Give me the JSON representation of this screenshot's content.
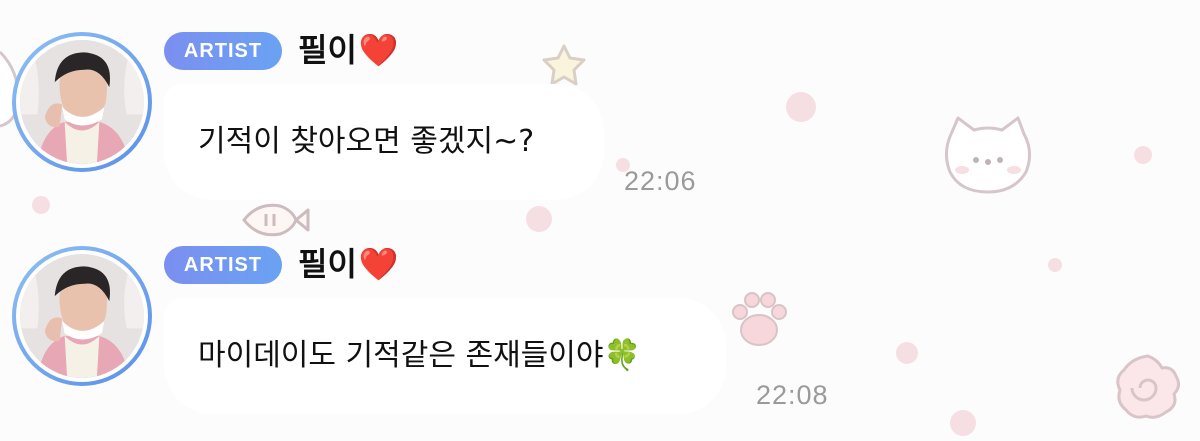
{
  "messages": [
    {
      "badge": "ARTIST",
      "sender_name": "필이",
      "heart": "❤️",
      "text": "기적이 찾아오면 좋겠지~?",
      "time": "22:06"
    },
    {
      "badge": "ARTIST",
      "sender_name": "필이",
      "heart": "❤️",
      "text": "마이데이도 기적같은 존재들이야",
      "emoji": "🍀",
      "time": "22:08"
    }
  ],
  "colors": {
    "badge_gradient_start": "#7b8ff0",
    "badge_gradient_end": "#6aa2f2",
    "avatar_ring": "#6aa2f2",
    "bubble": "#ffffff",
    "timestamp": "#9a9a9a",
    "heart": "#e3283a",
    "background_decor": "#f6dfe3"
  },
  "icons": {
    "avatar": "artist-avatar-photo",
    "decor": [
      "star-icon",
      "cat-face-icon",
      "fish-icon",
      "paw-icon",
      "swirl-icon",
      "bunny-icon"
    ]
  }
}
